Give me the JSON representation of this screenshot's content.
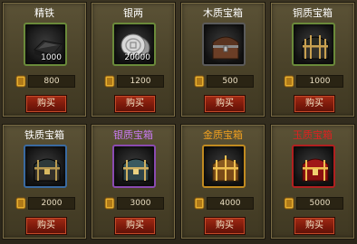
{
  "items": [
    {
      "name": "精铁",
      "name_color": "#ffffff",
      "frame_color": "#6a8a3a",
      "icon": "iron-ingot-icon",
      "quantity": "1000",
      "price": "800",
      "buy_label": "购买"
    },
    {
      "name": "银两",
      "name_color": "#ffffff",
      "frame_color": "#6a8a3a",
      "icon": "silver-coins-icon",
      "quantity": "20000",
      "price": "1200",
      "buy_label": "购买"
    },
    {
      "name": "木质宝箱",
      "name_color": "#ffffff",
      "frame_color": "#5a5a5a",
      "icon": "wooden-chest-icon",
      "quantity": "",
      "price": "500",
      "buy_label": "购买"
    },
    {
      "name": "铜质宝箱",
      "name_color": "#ffffff",
      "frame_color": "#6a8a3a",
      "icon": "copper-chest-icon",
      "quantity": "",
      "price": "1000",
      "buy_label": "购买"
    },
    {
      "name": "铁质宝箱",
      "name_color": "#ffffff",
      "frame_color": "#3a6aa0",
      "icon": "iron-chest-icon",
      "quantity": "",
      "price": "2000",
      "buy_label": "购买"
    },
    {
      "name": "银质宝箱",
      "name_color": "#c87af0",
      "frame_color": "#8a4ab0",
      "icon": "silver-chest-icon",
      "quantity": "",
      "price": "3000",
      "buy_label": "购买"
    },
    {
      "name": "金质宝箱",
      "name_color": "#f0a020",
      "frame_color": "#c08a20",
      "icon": "gold-chest-icon",
      "quantity": "",
      "price": "4000",
      "buy_label": "购买"
    },
    {
      "name": "玉质宝箱",
      "name_color": "#e02020",
      "frame_color": "#b02020",
      "icon": "jade-chest-icon",
      "quantity": "",
      "price": "5000",
      "buy_label": "购买"
    }
  ]
}
